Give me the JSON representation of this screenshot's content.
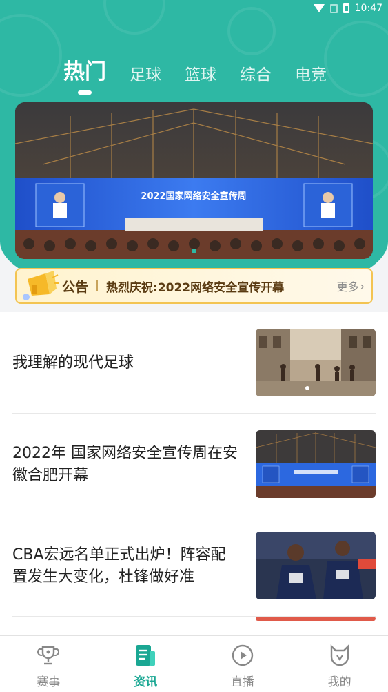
{
  "status_bar": {
    "time": "10:47"
  },
  "tabs": [
    {
      "label": "热门",
      "active": true
    },
    {
      "label": "足球",
      "active": false
    },
    {
      "label": "篮球",
      "active": false
    },
    {
      "label": "综合",
      "active": false
    },
    {
      "label": "电竞",
      "active": false
    }
  ],
  "banner": {
    "screen_title": "2022国家网络安全宣传周",
    "side_screen_text": "2022国家网络安全宣传周",
    "slide_count": 1
  },
  "notice": {
    "label": "公告",
    "text": "热烈庆祝:2022网络安全宣传开幕",
    "more": "更多"
  },
  "news": [
    {
      "title": "我理解的现代足球",
      "thumb_icon": "street-football-photo"
    },
    {
      "title": "2022年 国家网络安全宣传周在安徽合肥开幕",
      "thumb_icon": "conference-photo"
    },
    {
      "title": "CBA宏远名单正式出炉！阵容配置发生大变化，杜锋做好准",
      "thumb_icon": "basketball-players-photo"
    }
  ],
  "nav": [
    {
      "label": "赛事",
      "icon": "trophy-icon",
      "active": false
    },
    {
      "label": "资讯",
      "icon": "news-icon",
      "active": true
    },
    {
      "label": "直播",
      "icon": "play-icon",
      "active": false
    },
    {
      "label": "我的",
      "icon": "profile-icon",
      "active": false
    }
  ],
  "colors": {
    "brand": "#2eb8a4",
    "notice_border": "#f3c452",
    "active_nav": "#1aa793"
  }
}
